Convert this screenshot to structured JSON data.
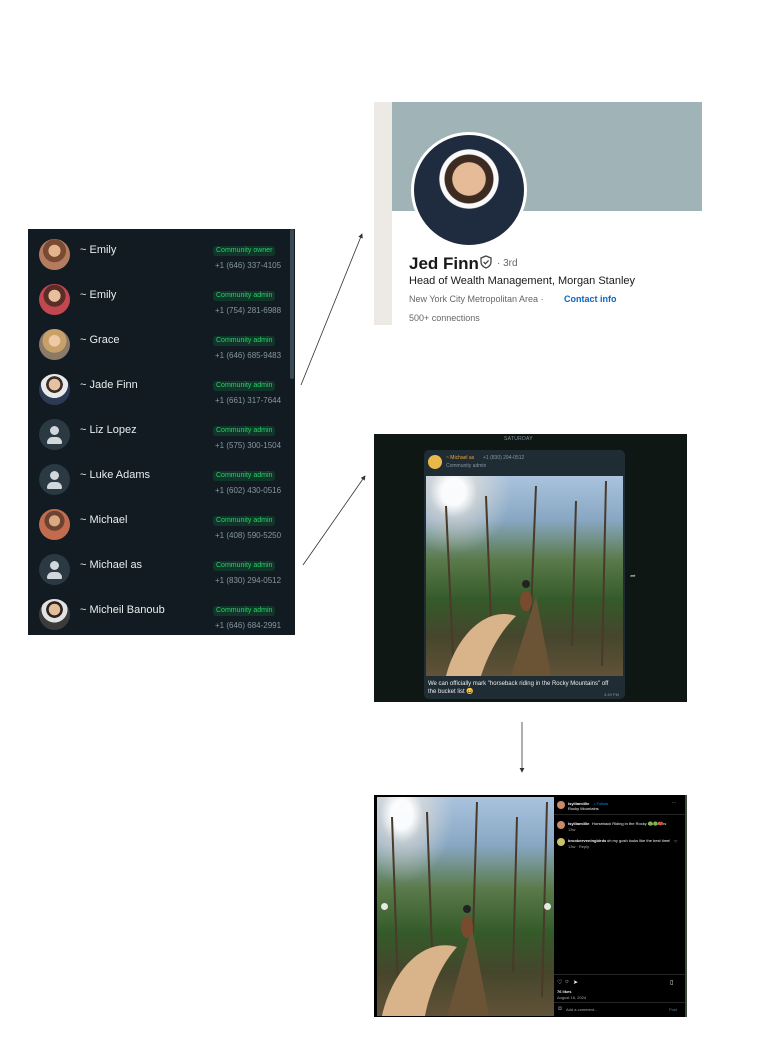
{
  "members": [
    {
      "name": "~ Emily",
      "role": "Community owner",
      "phone": "+1 (646) 337-4105",
      "avatar": "photo"
    },
    {
      "name": "~ Emily",
      "role": "Community admin",
      "phone": "+1 (754) 281-6988",
      "avatar": "photo2"
    },
    {
      "name": "~ Grace",
      "role": "Community admin",
      "phone": "+1 (646) 685-9483",
      "avatar": "photo3"
    },
    {
      "name": "~ Jade Finn",
      "role": "Community admin",
      "phone": "+1 (661) 317-7644",
      "avatar": "photo4"
    },
    {
      "name": "~ Liz Lopez",
      "role": "Community admin",
      "phone": "+1 (575) 300-1504",
      "avatar": "default"
    },
    {
      "name": "~ Luke Adams",
      "role": "Community admin",
      "phone": "+1 (602) 430-0516",
      "avatar": "default"
    },
    {
      "name": "~ Michael",
      "role": "Community admin",
      "phone": "+1 (408) 590-5250",
      "avatar": "photo5"
    },
    {
      "name": "~ Michael as",
      "role": "Community admin",
      "phone": "+1 (830) 294-0512",
      "avatar": "default"
    },
    {
      "name": "~ Micheil Banoub",
      "role": "Community admin",
      "phone": "+1 (646) 684-2991",
      "avatar": "photo6"
    }
  ],
  "linkedin": {
    "name": "Jed Finn",
    "degree": "· 3rd",
    "headline": "Head of Wealth Management, Morgan Stanley",
    "location": "New York City Metropolitan Area ·",
    "contact_info": "Contact info",
    "connections": "500+ connections",
    "banner_color": "#a0b4b7",
    "link_color": "#0a66c2"
  },
  "whatsapp": {
    "day_label": "SATURDAY",
    "sender": "~ Michael as",
    "sender_phone": "+1 (830) 294-0512",
    "sender_role": "Community admin",
    "message": "We can officially mark \"horseback riding in the Rocky Mountains\" off the bucket list 😄",
    "time": "3:49 PM",
    "bubble_color": "#1f2c33",
    "sender_color": "#e8a53f"
  },
  "instagram": {
    "username": "lsylliamillie",
    "follow": "• Follow",
    "location": "Rocky Mountains",
    "caption_user": "lsylliamillie",
    "caption": "Horseback Riding in the Rocky Mountains",
    "caption_time": "13w",
    "comment_user": "brookeeveningbirds",
    "comment": "oh my gosh looks like the best time!",
    "comment_meta": "13w · Reply",
    "likes": "76 likes",
    "date": "August 16, 2024",
    "add_comment": "Add a comment...",
    "post_label": "Post",
    "icons": [
      "more-icon",
      "heart-icon",
      "comment-icon",
      "share-icon",
      "bookmark-icon",
      "emoji-icon"
    ]
  },
  "colors": {
    "member_panel_bg": "#111b21",
    "badge_text": "#25d366",
    "badge_bg": "#103529"
  }
}
